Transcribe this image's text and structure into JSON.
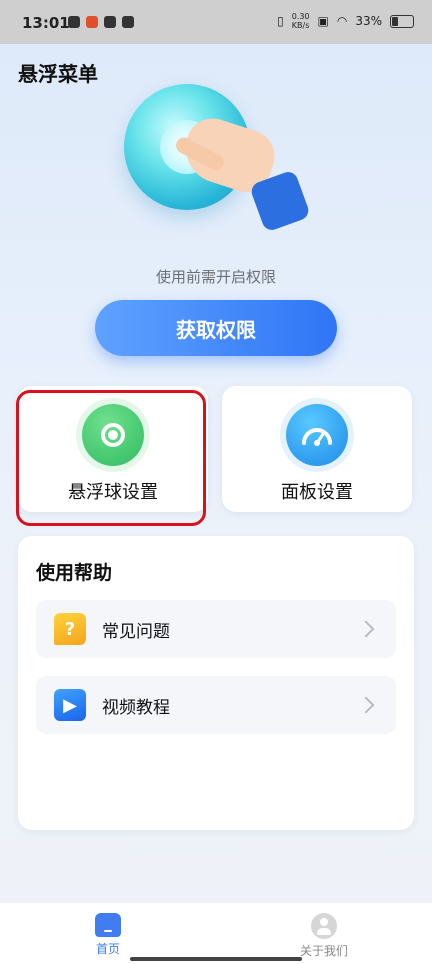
{
  "status_bar": {
    "time": "13:01",
    "speed_value": "0.30",
    "speed_unit": "KB/s",
    "battery": "33%"
  },
  "header": {
    "title": "悬浮菜单"
  },
  "permission": {
    "hint": "使用前需开启权限",
    "button_label": "获取权限"
  },
  "features": [
    {
      "label": "悬浮球设置",
      "icon": "floating-ball-icon",
      "color": "#2fbb62",
      "highlighted": true
    },
    {
      "label": "面板设置",
      "icon": "speedometer-icon",
      "color": "#1e8ae8",
      "highlighted": false
    }
  ],
  "help": {
    "title": "使用帮助",
    "items": [
      {
        "label": "常见问题",
        "icon": "question-bubble-icon",
        "glyph": "?"
      },
      {
        "label": "视频教程",
        "icon": "video-icon",
        "glyph": "▶"
      }
    ]
  },
  "tabs": [
    {
      "label": "首页",
      "icon": "home-icon",
      "active": true
    },
    {
      "label": "关于我们",
      "icon": "user-icon",
      "active": false
    }
  ],
  "colors": {
    "accent": "#2f75f5",
    "highlight_border": "#d9111f"
  }
}
